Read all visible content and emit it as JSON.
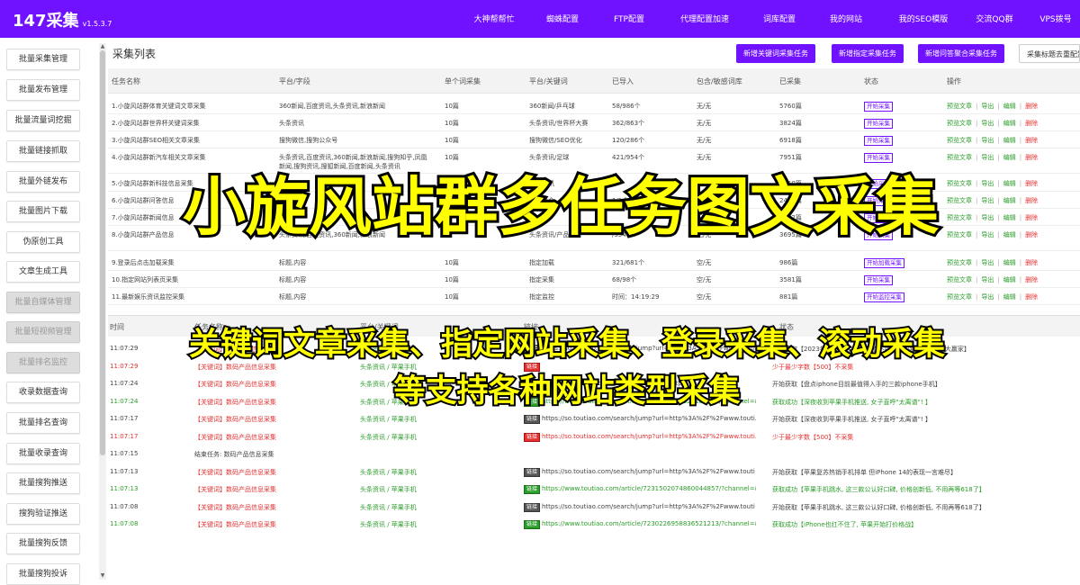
{
  "app": {
    "title": "147采集",
    "version": "v1.5.3.7"
  },
  "nav": [
    "大神帮帮忙",
    "蜘蛛配置",
    "FTP配置",
    "代理配置加速",
    "词库配置",
    "我的网站",
    "我的SEO模版",
    "交流QQ群",
    "VPS拨号"
  ],
  "sidebar": [
    "批量采集管理",
    "批量发布管理",
    "批量流量词挖掘",
    "批量链接抓取",
    "批量外链发布",
    "批量图片下载",
    "伪原创工具",
    "文章生成工具",
    "批量自媒体管理",
    "批量短视频管理",
    "批量排名监控",
    "收录数据查询",
    "批量排名查询",
    "批量收录查询",
    "批量搜狗推送",
    "搜狗验证推送",
    "批量搜狗反馈",
    "批量搜狗投诉"
  ],
  "page_title": "采集列表",
  "actions": [
    "新增关键词采集任务",
    "新增指定采集任务",
    "新增问答聚合采集任务",
    "采集标题去重配置"
  ],
  "table": {
    "headers": [
      "任务名称",
      "平台/字段",
      "单个词采集",
      "平台/关键词",
      "已导入",
      "包含/敏感词库",
      "已采集",
      "状态",
      "操作"
    ],
    "rows": [
      {
        "name": "1.小旋风站群体育关键词文章采集",
        "fields": "360新闻,百度资讯,头条资讯,新浪新闻",
        "single": "10篇",
        "platform": "360新闻/乒乓球",
        "imported": "58/986个",
        "incl": "无/无",
        "collected": "5760篇",
        "status": "开始采集"
      },
      {
        "name": "2.小旋风站群世界杯关键词采集",
        "fields": "头条资讯",
        "single": "10篇",
        "platform": "头条资讯/世界杯大赛",
        "imported": "362/863个",
        "incl": "无/无",
        "collected": "3824篇",
        "status": "开始采集"
      },
      {
        "name": "3.小旋风站群SEO相关文章采集",
        "fields": "搜狗微信,搜狗公众号",
        "single": "10篇",
        "platform": "搜狗微信/SEO优化",
        "imported": "120/286个",
        "incl": "无/无",
        "collected": "6918篇",
        "status": "开始采集"
      },
      {
        "name": "4.小旋风站群新汽车相关文章采集",
        "fields": "头条资讯,百度资讯,360新闻,新浪新闻,搜狗知乎,凤凰新闻,搜狗资讯,搜狐新闻,百度新闻,头条资讯",
        "single": "10篇",
        "platform": "头条资讯/足球",
        "imported": "421/954个",
        "incl": "无/无",
        "collected": "7951篇",
        "status": "开始采集"
      },
      {
        "name": "5.小旋风站群新科技信息采集",
        "fields": "",
        "single": "",
        "platform": "头条资讯",
        "imported": "",
        "incl": "空/无",
        "collected": "1850篇",
        "status": "开始采集"
      },
      {
        "name": "6.小旋风站群问答信息",
        "fields": "",
        "single": "",
        "platform": "问答聚合",
        "imported": "1/1个",
        "incl": "空/无",
        "collected": "2456篇",
        "status": "开始采集"
      },
      {
        "name": "7.小旋风站群新闻信息",
        "fields": "",
        "single": "",
        "platform": "",
        "imported": "",
        "incl": "无/无",
        "collected": "8532篇",
        "status": "开始采集"
      },
      {
        "name": "8.小旋风站群产品信息",
        "fields": "头条资讯,百度资讯,360新闻,新浪新闻",
        "single": "",
        "platform": "头条资讯/产品",
        "imported": "/954个",
        "incl": "无/无",
        "collected": "3695篇",
        "status": "开始采集"
      },
      {
        "name": "9.登录后点击加载采集",
        "fields": "标题,内容",
        "single": "10篇",
        "platform": "指定加载",
        "imported": "321/681个",
        "incl": "空/无",
        "collected": "986篇",
        "status": "开始加载采集"
      },
      {
        "name": "10.指定网站列表页采集",
        "fields": "标题,内容",
        "single": "10篇",
        "platform": "指定采集",
        "imported": "68/98个",
        "incl": "空/无",
        "collected": "3581篇",
        "status": "开始采集"
      },
      {
        "name": "11.最新娱乐资讯监控采集",
        "fields": "标题,内容",
        "single": "10篇",
        "platform": "指定监控",
        "imported": "时间：14:19:29",
        "incl": "空/无",
        "collected": "881篇",
        "status": "开始监控采集"
      }
    ],
    "op_labels": [
      "预览文章",
      "导出",
      "编辑",
      "删除"
    ]
  },
  "log": {
    "headers": [
      "时间",
      "任务名称",
      "平台/关键词",
      "链接",
      "状态"
    ],
    "rows": [
      {
        "time": "11:07:29",
        "task": "【关键词】数码产品信息采集",
        "kw": "头条资讯 / 苹果手机",
        "tag": "链接",
        "url": "https://so.toutiao.com/search/jump?url=http%3A%2F%2Fwww.toutiao",
        "msg": "开始获取【2023年618手机大战收官 不错此报的苹果, 又是最大赢家】",
        "color": "gray",
        "tagc": "dark"
      },
      {
        "time": "11:07:29",
        "task": "【关键词】数码产品信息采集",
        "kw": "头条资讯 / 苹果手机",
        "tag": "链接",
        "url": "",
        "msg": "少于最少字数【500】不采集",
        "color": "red",
        "tagc": "red"
      },
      {
        "time": "11:07:24",
        "task": "【关键词】数码产品信息采集",
        "kw": "头条资讯 / 苹果手机",
        "tag": "链接",
        "url": "https://so.toutiao.com/search/jump?url=http",
        "msg": "开始获取【盘点iphone目前最值得入手的三款iphone手机】",
        "color": "gray",
        "tagc": "dark"
      },
      {
        "time": "11:07:24",
        "task": "【关键词】数码产品信息采集",
        "kw": "头条资讯 / 苹果手机",
        "tag": "链接",
        "url": "https://www.toutiao.com/article/7245062749326180879/?channel=&...",
        "msg": "获取成功【深夜收到苹果手机推送, 女子直呼\"太离谱\"! 】",
        "color": "green",
        "tagc": "green"
      },
      {
        "time": "11:07:17",
        "task": "【关键词】数码产品信息采集",
        "kw": "头条资讯 / 苹果手机",
        "tag": "链接",
        "url": "https://so.toutiao.com/search/jump?url=http%3A%2F%2Fwww.touti...",
        "msg": "开始获取【深夜收到苹果手机推送, 女子直呼\"太离谱\"! 】",
        "color": "gray",
        "tagc": "dark"
      },
      {
        "time": "11:07:17",
        "task": "【关键词】数码产品信息采集",
        "kw": "头条资讯 / 苹果手机",
        "tag": "链接",
        "url": "https://so.toutiao.com/search/jump?url=http%3A%2F%2Fwww.touti...",
        "msg": "少于最少字数【500】不采集",
        "color": "red",
        "tagc": "red"
      },
      {
        "time": "11:07:15",
        "task": "结束任务: 数码产品信息采集",
        "kw": "",
        "tag": "",
        "url": "",
        "msg": "",
        "color": "gray",
        "tagc": ""
      },
      {
        "time": "11:07:13",
        "task": "【关键词】数码产品信息采集",
        "kw": "头条资讯 / 苹果手机",
        "tag": "链接",
        "url": "https://so.toutiao.com/search/jump?url=http%3A%2F%2Fwww.touti",
        "msg": "开始获取【苹果复苏热销手机排单 但iPhone 14的表现一言难尽】",
        "color": "gray",
        "tagc": "dark"
      },
      {
        "time": "11:07:13",
        "task": "【关键词】数码产品信息采集",
        "kw": "头条资讯 / 苹果手机",
        "tag": "链接",
        "url": "https://www.toutiao.com/article/7231502074860044857/?channel=&...",
        "msg": "获取成功【苹果手机跳水, 这三款公认好口碑, 价格创新低, 不用再等618了】",
        "color": "green",
        "tagc": "green"
      },
      {
        "time": "11:07:08",
        "task": "【关键词】数码产品信息采集",
        "kw": "头条资讯 / 苹果手机",
        "tag": "链接",
        "url": "https://so.toutiao.com/search/jump?url=http%3A%2F%2Fwww.touti",
        "msg": "开始获取【苹果手机跳水, 这三款公认好口碑, 价格创新低, 不用再等618了】",
        "color": "gray",
        "tagc": "dark"
      },
      {
        "time": "11:07:08",
        "task": "【关键词】数码产品信息采集",
        "kw": "头条资讯 / 苹果手机",
        "tag": "链接",
        "url": "https://www.toutiao.com/article/7230226958836521213/?channel=&",
        "msg": "获取成功【iPhone也扛不住了, 苹果开始打价格战】",
        "color": "green",
        "tagc": "green"
      }
    ]
  },
  "overlay": {
    "title": "小旋风站群多任务图文采集",
    "line1": "关键词文章采集、指定网站采集、登录采集、滚动采集",
    "line2": "等支持各种网站类型采集"
  },
  "colors": {
    "brand": "#7012ff",
    "success": "#2a9d2a",
    "danger": "#e23131",
    "overlay_text": "#ffff00"
  }
}
